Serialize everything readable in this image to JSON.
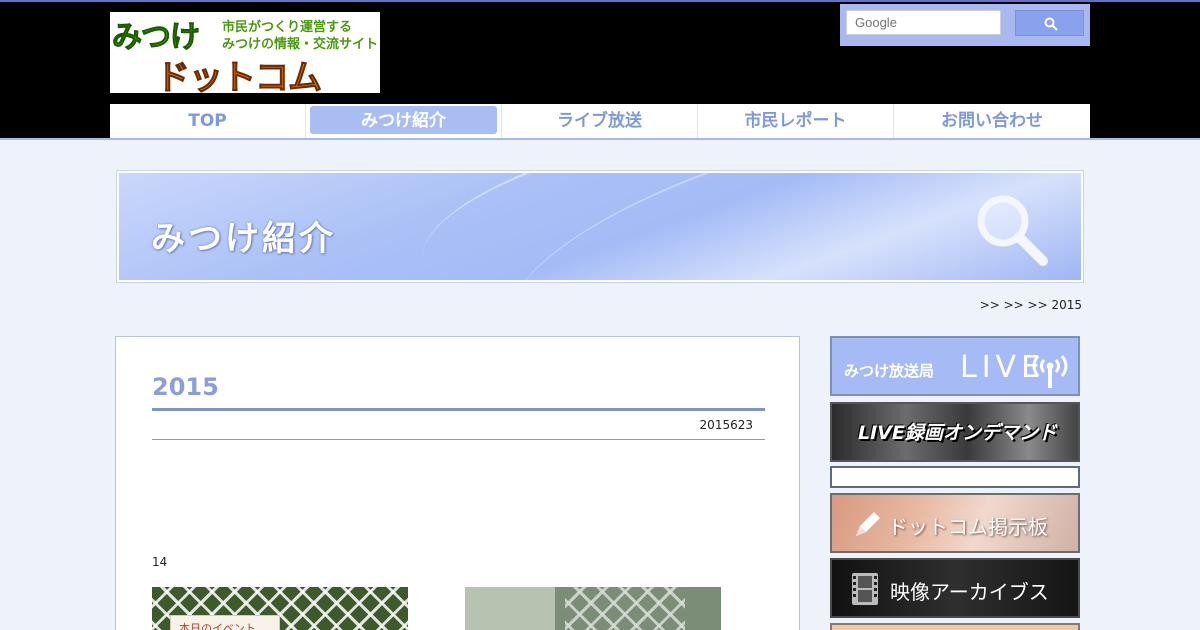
{
  "header": {
    "logo": {
      "name_line1": "みつけ",
      "name_line2": "ドットコム",
      "tagline1": "市民がつくり運営する",
      "tagline2": "みつけの情報・交流サイト"
    },
    "search": {
      "placeholder": "Google"
    }
  },
  "nav": {
    "items": [
      {
        "label": "TOP"
      },
      {
        "label": "みつけ紹介"
      },
      {
        "label": "ライブ放送"
      },
      {
        "label": "市民レポート"
      },
      {
        "label": "お問い合わせ"
      }
    ]
  },
  "banner": {
    "title": "みつけ紹介"
  },
  "breadcrumb": {
    "text": ">>  >>  >> 2015"
  },
  "post": {
    "title": "2015",
    "date": "2015623",
    "text": "14",
    "photo1_sign": "本日のイベント"
  },
  "sidebar": {
    "live_label": "みつけ放送局",
    "live_big": "LIVE",
    "vod_label": "LIVE録画オンデマンド",
    "board_label": "ドットコム掲示板",
    "archive_label": "映像アーカイブス"
  },
  "colors": {
    "nav_text": "#7f99df",
    "nav_active_bg": "#a9bdf3",
    "title_text": "#8b9ed6",
    "search_button": "#8aa1ec"
  }
}
